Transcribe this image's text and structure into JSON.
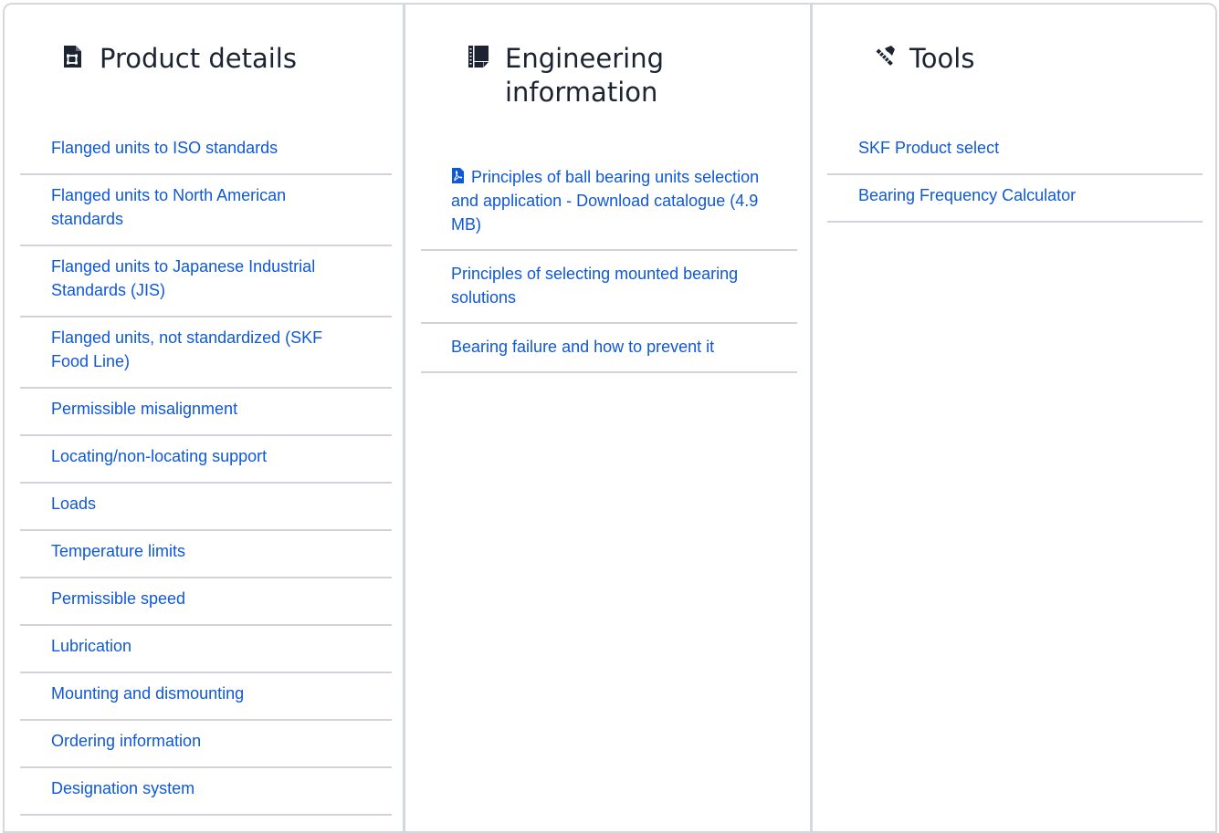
{
  "product_details": {
    "title": "Product details",
    "icon": "product-sheet-icon",
    "links": [
      "Flanged units to ISO standards",
      "Flanged units to North American standards",
      "Flanged units to Japanese Industrial Standards (JIS)",
      "Flanged units, not standardized (SKF Food Line)",
      "Permissible misalignment",
      "Locating/non-locating support",
      "Loads",
      "Temperature limits",
      "Permissible speed",
      "Lubrication",
      "Mounting and dismounting",
      "Ordering information",
      "Designation system"
    ]
  },
  "engineering_information": {
    "title": "Engineering information",
    "icon": "engineering-book-icon",
    "links": [
      {
        "label": "Principles of ball bearing units selection and application - Download catalogue (4.9 MB)",
        "icon": "pdf-icon"
      },
      {
        "label": "Principles of selecting mounted bearing solutions"
      },
      {
        "label": "Bearing failure and how to prevent it"
      }
    ]
  },
  "tools": {
    "title": "Tools",
    "icon": "hammer-ruler-icon",
    "links": [
      "SKF Product select",
      "Bearing Frequency Calculator"
    ]
  },
  "colors": {
    "link": "#0f58d6",
    "heading": "#1c2331",
    "divider": "#d0d3d8",
    "border": "#d4d7dc"
  }
}
